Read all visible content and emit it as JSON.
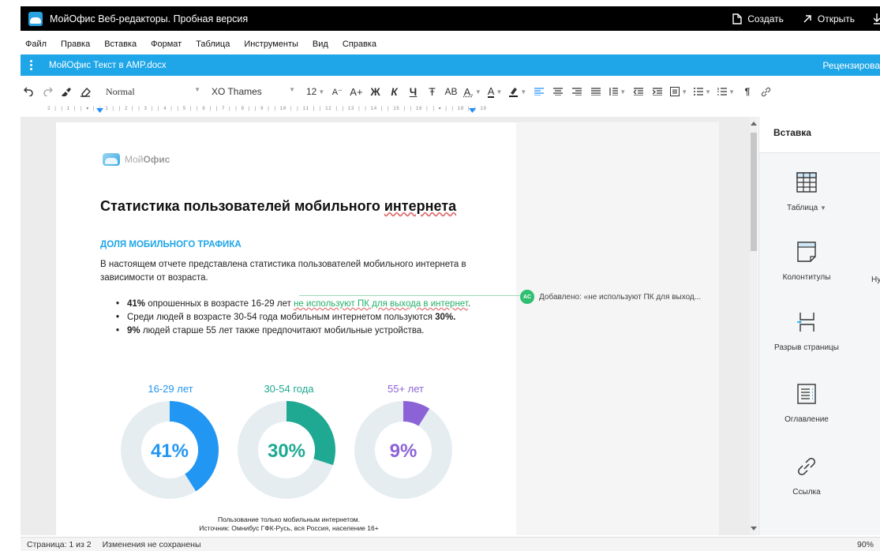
{
  "titlebar": {
    "app_title": "МойОфис Веб-редакторы. Пробная версия",
    "create_label": "Создать",
    "open_label": "Открыть"
  },
  "menu": [
    "Файл",
    "Правка",
    "Вставка",
    "Формат",
    "Таблица",
    "Инструменты",
    "Вид",
    "Справка"
  ],
  "docbar": {
    "file_name": "МойОфис Текст в AMP.docx",
    "mode_label": "Рецензирова"
  },
  "toolbar": {
    "style": "Normal",
    "font": "XO Thames",
    "size": "12",
    "decrease_font": "A⁻",
    "increase_font": "A+",
    "bold": "Ж",
    "italic": "К",
    "underline": "Ч",
    "strike": "Ŧ",
    "caps": "AB",
    "pilcrow": "¶"
  },
  "ruler": "2 | | 1 | |  ▾ | | 1 | | 2 | | 3 | | 4 | | 5 | | 6 | | 7 | | 8 | | 9 | | 10 | | 11 | | 12 | | 13 | | 14 | | 15 | | 16 | | ▾ | | 18 | | 19",
  "document": {
    "brand_prefix": "Мой",
    "brand_suffix": "Офис",
    "title": "Статистика пользователей мобильного ",
    "title_wave": "интернета",
    "section_heading": "ДОЛЯ МОБИЛЬНОГО ТРАФИКА",
    "paragraph": "В настоящем отчете представлена статистика пользователей мобильного интернета в зависимости от возраста.",
    "bullet1_bold": "41%",
    "bullet1_text": " опрошенных в возрасте 16-29 лет ",
    "bullet1_inserted": "не используют ПК для выхода в интернет",
    "bullet1_end": ".",
    "bullet2_text": "Среди людей в возрасте 30-54 года мобильным интернетом пользуются ",
    "bullet2_bold": "30%.",
    "bullet3_bold": "9%",
    "bullet3_text": " людей старше 55 лет также предпочитают мобильные устройства.",
    "donuts": [
      {
        "label": "16-29 лет",
        "value": 41,
        "text": "41%",
        "color": "#2196f3"
      },
      {
        "label": "30-54 года",
        "value": 30,
        "text": "30%",
        "color": "#1fa993"
      },
      {
        "label": "55+ лет",
        "value": 9,
        "text": "9%",
        "color": "#8c63d6"
      }
    ],
    "source_line1": "Пользование только мобильным интернетом.",
    "source_line2": "Источник: Омнибус ГФК-Русь, вся Россия, население 16+"
  },
  "comment": {
    "initials": "AC",
    "text": "Добавлено: «не используют ПК для выход..."
  },
  "right_panel": {
    "title": "Вставка",
    "items": [
      "Таблица",
      "Колонтитулы",
      "Разрыв страницы",
      "Оглавление",
      "Ссылка"
    ],
    "cut_label": "Ну"
  },
  "statusbar": {
    "page": "Страница: 1 из 2",
    "save_state": "Изменения не сохранены",
    "zoom": "90%"
  },
  "colors": {
    "accent": "#1ea6e8",
    "inserted_text": "#22b06a"
  }
}
